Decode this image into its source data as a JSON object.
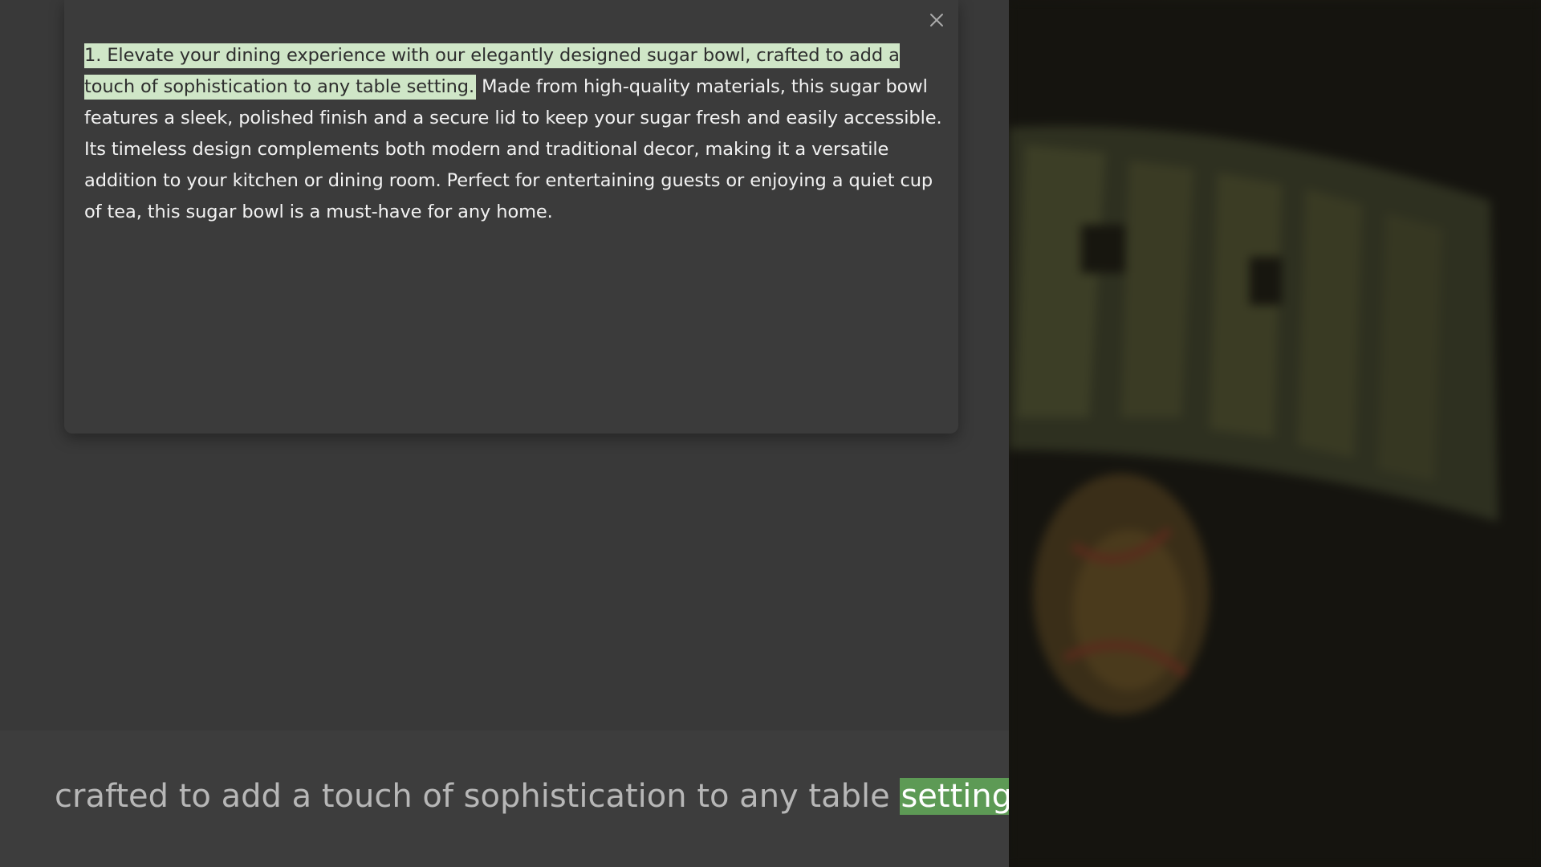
{
  "reader": {
    "highlighted_sentence": "1. Elevate your dining experience with our elegantly designed sugar bowl, crafted to add a touch of sophistication to any table setting.",
    "rest_text": " Made from high-quality materials, this sugar bowl features a sleek, polished finish and a secure lid to keep your sugar fresh and easily accessible. Its timeless design complements both modern and traditional decor, making it a versatile addition to your kitchen or dining room. Perfect for entertaining guests or enjoying a quiet cup of tea, this sugar bowl is a must-have for any home.",
    "close_icon": "close-icon"
  },
  "caption": {
    "before": "crafted to add a touch of sophistication to any table ",
    "current_word": "setting",
    "after": "."
  },
  "colors": {
    "sentence_highlight": "#cfe6c7",
    "word_highlight": "#5d9a55",
    "background": "#393939"
  }
}
